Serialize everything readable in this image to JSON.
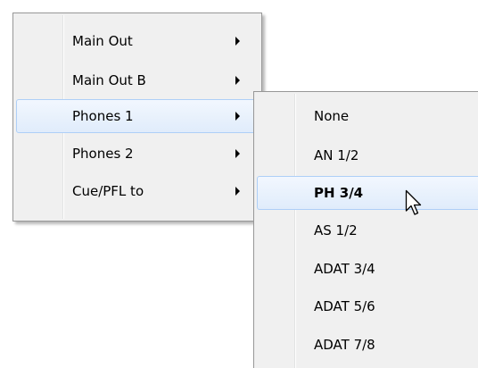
{
  "main_menu": {
    "items": [
      {
        "label": "Main Out"
      },
      {
        "label": "Main Out B"
      },
      {
        "label": "Phones 1"
      },
      {
        "label": "Phones 2"
      },
      {
        "label": "Cue/PFL to"
      }
    ],
    "highlighted": "Phones 1",
    "arrow_icon": "submenu-arrow-icon"
  },
  "sub_menu": {
    "items": [
      {
        "label": "None"
      },
      {
        "label": "AN 1/2"
      },
      {
        "label": "PH 3/4"
      },
      {
        "label": "AS 1/2"
      },
      {
        "label": "ADAT 3/4"
      },
      {
        "label": "ADAT 5/6"
      },
      {
        "label": "ADAT 7/8"
      }
    ],
    "selected": "PH 3/4"
  },
  "cursor_icon": "mouse-pointer-icon",
  "colors": {
    "menu_background": "#f0f0f0",
    "menu_border": "#979797",
    "highlight_border": "#aecff7",
    "highlight_fill": "#e0ecfb"
  }
}
